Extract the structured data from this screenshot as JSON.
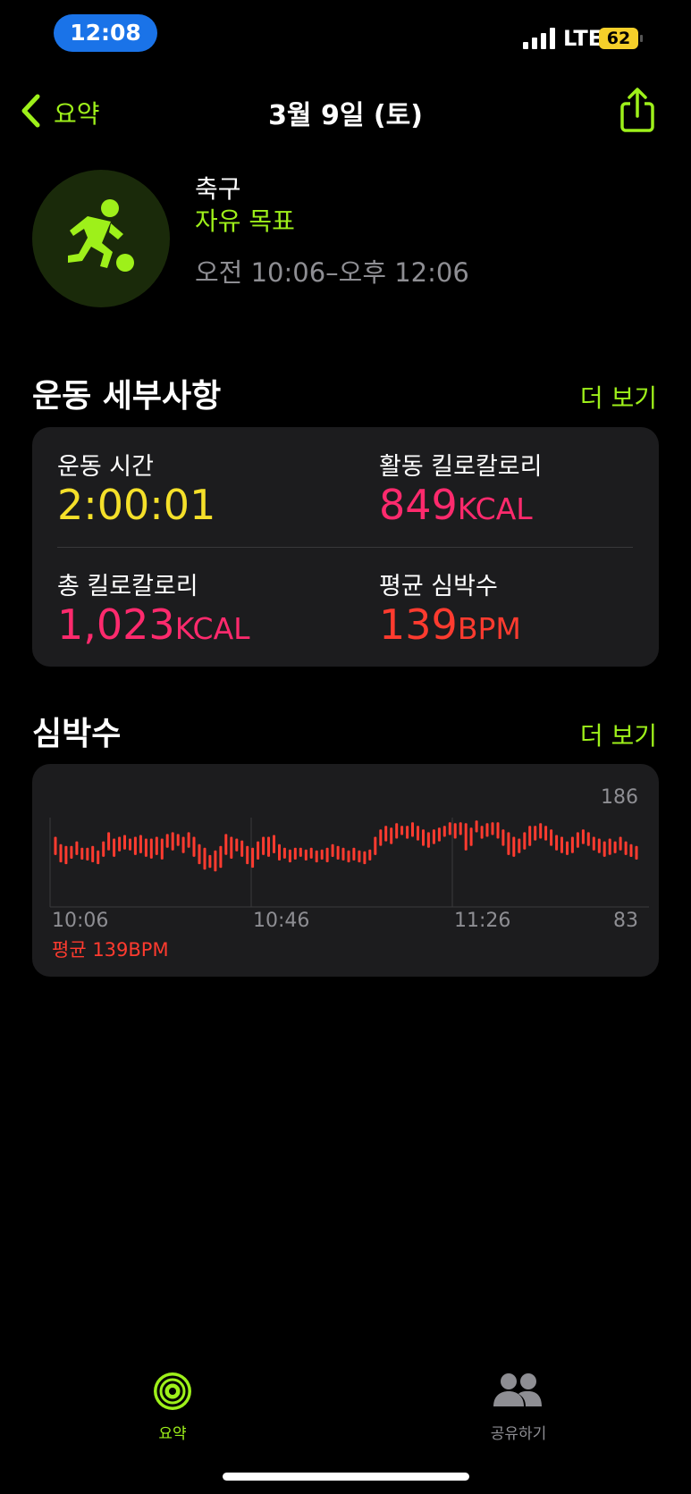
{
  "status_bar": {
    "time": "12:08",
    "network": "LTE",
    "battery": "62"
  },
  "nav": {
    "back_label": "요약",
    "title": "3월 9일 (토)"
  },
  "workout": {
    "name": "축구",
    "goal": "자유 목표",
    "time_range": "오전 10:06–오후 12:06",
    "icon": "soccer-player-icon"
  },
  "details": {
    "title": "운동 세부사항",
    "more": "더 보기",
    "stats": [
      {
        "label": "운동 시간",
        "value": "2:00:01",
        "unit": "",
        "color": "#f5e02a"
      },
      {
        "label": "활동 킬로칼로리",
        "value": "849",
        "unit": "KCAL",
        "color": "#ff2a6d"
      },
      {
        "label": "총 킬로칼로리",
        "value": "1,023",
        "unit": "KCAL",
        "color": "#ff2a6d"
      },
      {
        "label": "평균 심박수",
        "value": "139",
        "unit": "BPM",
        "color": "#ff3b2f"
      }
    ]
  },
  "heart_rate": {
    "title": "심박수",
    "more": "더 보기",
    "avg_label": "평균 139BPM"
  },
  "chart_data": {
    "type": "bar",
    "x_ticks": [
      "10:06",
      "10:46",
      "11:26"
    ],
    "y_max_label": "186",
    "y_min_label": "83",
    "ylim": [
      83,
      186
    ],
    "grid": true,
    "color": "#ff3b2f",
    "ranges": [
      [
        140,
        160
      ],
      [
        132,
        152
      ],
      [
        130,
        150
      ],
      [
        136,
        150
      ],
      [
        140,
        155
      ],
      [
        135,
        148
      ],
      [
        134,
        148
      ],
      [
        132,
        150
      ],
      [
        130,
        145
      ],
      [
        138,
        155
      ],
      [
        145,
        165
      ],
      [
        138,
        158
      ],
      [
        144,
        160
      ],
      [
        146,
        162
      ],
      [
        145,
        158
      ],
      [
        140,
        160
      ],
      [
        142,
        162
      ],
      [
        138,
        158
      ],
      [
        136,
        158
      ],
      [
        140,
        160
      ],
      [
        135,
        158
      ],
      [
        148,
        163
      ],
      [
        145,
        165
      ],
      [
        150,
        163
      ],
      [
        142,
        160
      ],
      [
        148,
        165
      ],
      [
        138,
        160
      ],
      [
        130,
        152
      ],
      [
        124,
        148
      ],
      [
        126,
        140
      ],
      [
        122,
        145
      ],
      [
        126,
        150
      ],
      [
        140,
        163
      ],
      [
        136,
        160
      ],
      [
        144,
        158
      ],
      [
        138,
        156
      ],
      [
        130,
        150
      ],
      [
        126,
        148
      ],
      [
        135,
        155
      ],
      [
        140,
        160
      ],
      [
        138,
        160
      ],
      [
        142,
        162
      ],
      [
        134,
        152
      ],
      [
        136,
        148
      ],
      [
        132,
        146
      ],
      [
        135,
        148
      ],
      [
        138,
        148
      ],
      [
        134,
        146
      ],
      [
        136,
        148
      ],
      [
        132,
        145
      ],
      [
        135,
        146
      ],
      [
        132,
        148
      ],
      [
        138,
        152
      ],
      [
        135,
        150
      ],
      [
        134,
        148
      ],
      [
        132,
        145
      ],
      [
        134,
        148
      ],
      [
        132,
        145
      ],
      [
        130,
        144
      ],
      [
        134,
        146
      ],
      [
        140,
        160
      ],
      [
        150,
        168
      ],
      [
        155,
        172
      ],
      [
        152,
        170
      ],
      [
        158,
        175
      ],
      [
        162,
        172
      ],
      [
        158,
        172
      ],
      [
        160,
        176
      ],
      [
        156,
        172
      ],
      [
        150,
        168
      ],
      [
        148,
        165
      ],
      [
        152,
        168
      ],
      [
        155,
        170
      ],
      [
        160,
        172
      ],
      [
        162,
        176
      ],
      [
        158,
        175
      ],
      [
        162,
        176
      ],
      [
        145,
        175
      ],
      [
        150,
        170
      ],
      [
        165,
        178
      ],
      [
        158,
        172
      ],
      [
        160,
        175
      ],
      [
        162,
        176
      ],
      [
        158,
        176
      ],
      [
        150,
        168
      ],
      [
        140,
        165
      ],
      [
        138,
        160
      ],
      [
        142,
        158
      ],
      [
        146,
        165
      ],
      [
        150,
        172
      ],
      [
        156,
        172
      ],
      [
        158,
        175
      ],
      [
        156,
        172
      ],
      [
        150,
        168
      ],
      [
        145,
        162
      ],
      [
        142,
        160
      ],
      [
        140,
        155
      ],
      [
        142,
        160
      ],
      [
        148,
        165
      ],
      [
        152,
        168
      ],
      [
        150,
        165
      ],
      [
        145,
        160
      ],
      [
        142,
        158
      ],
      [
        138,
        155
      ],
      [
        140,
        158
      ],
      [
        142,
        155
      ],
      [
        145,
        160
      ],
      [
        140,
        155
      ],
      [
        138,
        152
      ],
      [
        135,
        150
      ]
    ]
  },
  "tab_bar": {
    "tabs": [
      {
        "label": "요약",
        "icon": "activity-rings-icon",
        "active": true
      },
      {
        "label": "공유하기",
        "icon": "people-icon",
        "active": false
      }
    ]
  }
}
